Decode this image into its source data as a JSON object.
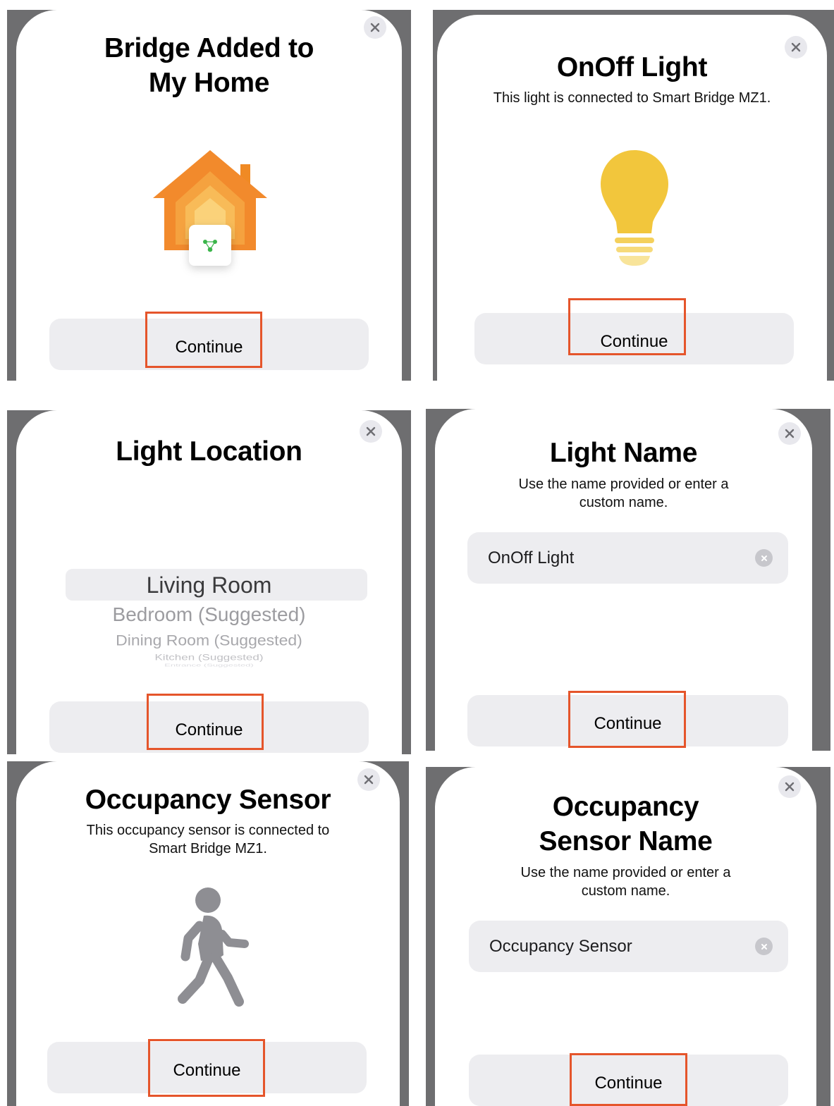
{
  "colors": {
    "highlight": "#e5552b",
    "button_bg": "#ededf0",
    "frame": "#6e6e70",
    "house_orange": "#f2882b",
    "bulb_yellow": "#f2c63c",
    "sensor_gray": "#8e8e93"
  },
  "panels": {
    "bridge_added": {
      "title_line1": "Bridge Added to",
      "title_line2": "My Home",
      "icon": "home-with-bridge-icon",
      "continue_label": "Continue"
    },
    "onoff_light": {
      "title": "OnOff Light",
      "subtitle": "This light is connected to Smart Bridge MZ1.",
      "icon": "lightbulb-icon",
      "continue_label": "Continue"
    },
    "light_location": {
      "title": "Light Location",
      "picker_options": [
        "Living Room",
        "Bedroom (Suggested)",
        "Dining Room (Suggested)",
        "Kitchen (Suggested)",
        "Entrance (Suggested)"
      ],
      "selected_option": "Living Room",
      "continue_label": "Continue"
    },
    "light_name": {
      "title": "Light Name",
      "subtitle_line1": "Use the name provided or enter a",
      "subtitle_line2": "custom name.",
      "name_value": "OnOff Light",
      "continue_label": "Continue"
    },
    "occupancy_sensor": {
      "title": "Occupancy Sensor",
      "subtitle_line1": "This occupancy sensor is connected to",
      "subtitle_line2": "Smart Bridge MZ1.",
      "icon": "person-walking-icon",
      "continue_label": "Continue"
    },
    "occupancy_sensor_name": {
      "title_line1": "Occupancy",
      "title_line2": "Sensor Name",
      "subtitle_line1": "Use the name provided or enter a",
      "subtitle_line2": "custom name.",
      "name_value": "Occupancy Sensor",
      "continue_label": "Continue"
    }
  }
}
